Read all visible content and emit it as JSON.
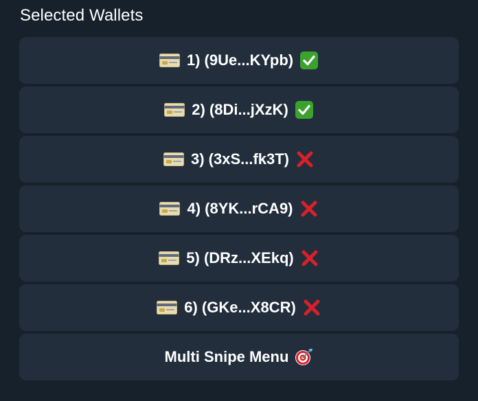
{
  "header": {
    "title": "Selected Wallets"
  },
  "wallets": [
    {
      "label": "1) (9Ue...KYpb)",
      "status": "selected",
      "status_icon": "check-mark-icon"
    },
    {
      "label": "2) (8Di...jXzK)",
      "status": "selected",
      "status_icon": "check-mark-icon"
    },
    {
      "label": "3) (3xS...fk3T)",
      "status": "unselected",
      "status_icon": "cross-mark-icon"
    },
    {
      "label": "4) (8YK...rCA9)",
      "status": "unselected",
      "status_icon": "cross-mark-icon"
    },
    {
      "label": "5) (DRz...XEkq)",
      "status": "unselected",
      "status_icon": "cross-mark-icon"
    },
    {
      "label": "6) (GKe...X8CR)",
      "status": "unselected",
      "status_icon": "cross-mark-icon"
    }
  ],
  "menu": {
    "label": "Multi Snipe Menu",
    "icon": "target-icon"
  },
  "colors": {
    "background": "#17212b",
    "button": "#222e3c",
    "check": "#3ba22e",
    "cross": "#d8202a"
  }
}
